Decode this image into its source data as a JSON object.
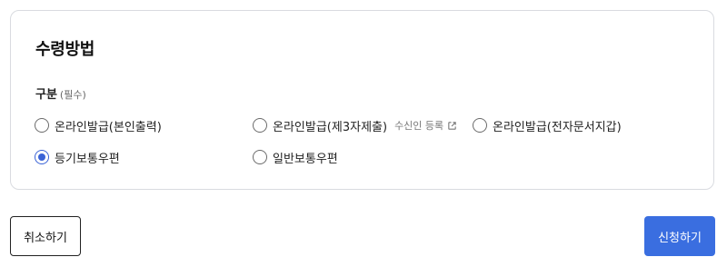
{
  "section": {
    "title": "수령방법",
    "field_label": "구분",
    "required_text": "(필수)"
  },
  "options": [
    {
      "label": "온라인발급(본인출력)",
      "checked": false
    },
    {
      "label": "온라인발급(제3자제출)",
      "checked": false,
      "sub_link": "수신인 등록",
      "sub_link_icon": "external-link-icon"
    },
    {
      "label": "온라인발급(전자문서지갑)",
      "checked": false
    },
    {
      "label": "등기보통우편",
      "checked": true
    },
    {
      "label": "일반보통우편",
      "checked": false
    }
  ],
  "buttons": {
    "cancel_label": "취소하기",
    "submit_label": "신청하기"
  },
  "colors": {
    "accent": "#3a63d6",
    "submit_bg": "#3a6ee0",
    "border": "#d9dbe0"
  }
}
